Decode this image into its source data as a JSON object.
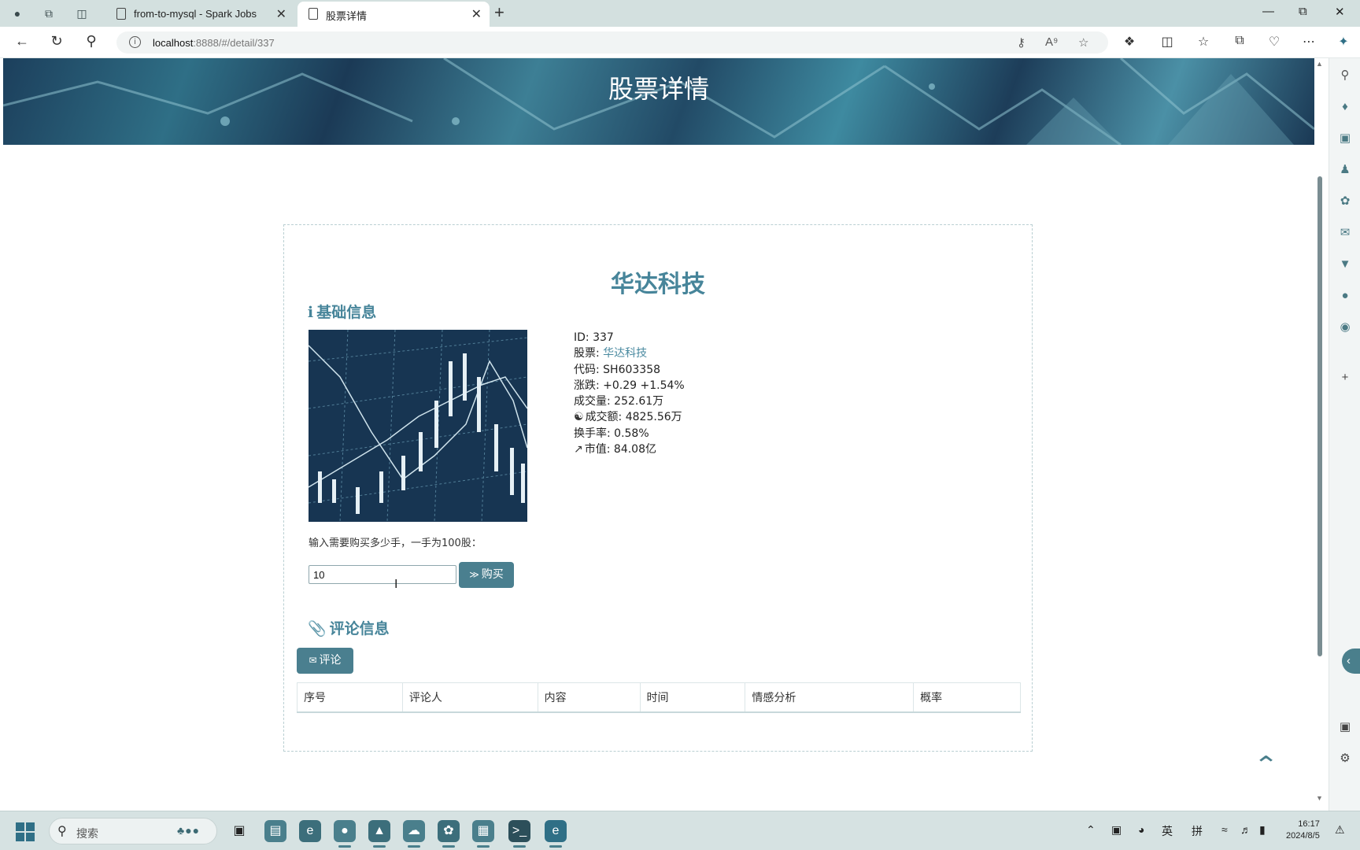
{
  "browser": {
    "tabs": [
      {
        "title": "from-to-mysql - Spark Jobs"
      },
      {
        "title": "股票详情"
      }
    ],
    "url": {
      "host": "localhost",
      "path": ":8888/#/detail/337"
    }
  },
  "page": {
    "banner_title": "股票详情",
    "stock_name": "华达科技",
    "basic_section": {
      "title": "基础信息",
      "rows": [
        {
          "label": "ID:",
          "value": "337"
        },
        {
          "label": "股票:",
          "value": "华达科技"
        },
        {
          "label": "代码:",
          "value": "SH603358"
        },
        {
          "label": "涨跌:",
          "value": "+0.29 +1.54%"
        },
        {
          "label": "成交量:",
          "value": "252.61万"
        },
        {
          "label": "成交额:",
          "value": "4825.56万"
        },
        {
          "label": "换手率:",
          "value": "0.58%"
        },
        {
          "label": "市值:",
          "value": "84.08亿"
        }
      ]
    },
    "buy": {
      "prompt": "输入需要购买多少手，一手为100股：",
      "quantity": "10",
      "button": "购买"
    },
    "comment_section": {
      "title": "评论信息",
      "button": "评论",
      "columns": [
        "序号",
        "评论人",
        "内容",
        "时间",
        "情感分析",
        "概率"
      ],
      "rows": []
    }
  },
  "taskbar": {
    "search_placeholder": "搜索",
    "ime_lang": "英",
    "ime_mode": "拼",
    "time": "16:17",
    "date": "2024/8/5"
  },
  "colors": {
    "accent": "#47859a",
    "button": "#4a7f8f",
    "tabbar": "#d3e0df"
  }
}
